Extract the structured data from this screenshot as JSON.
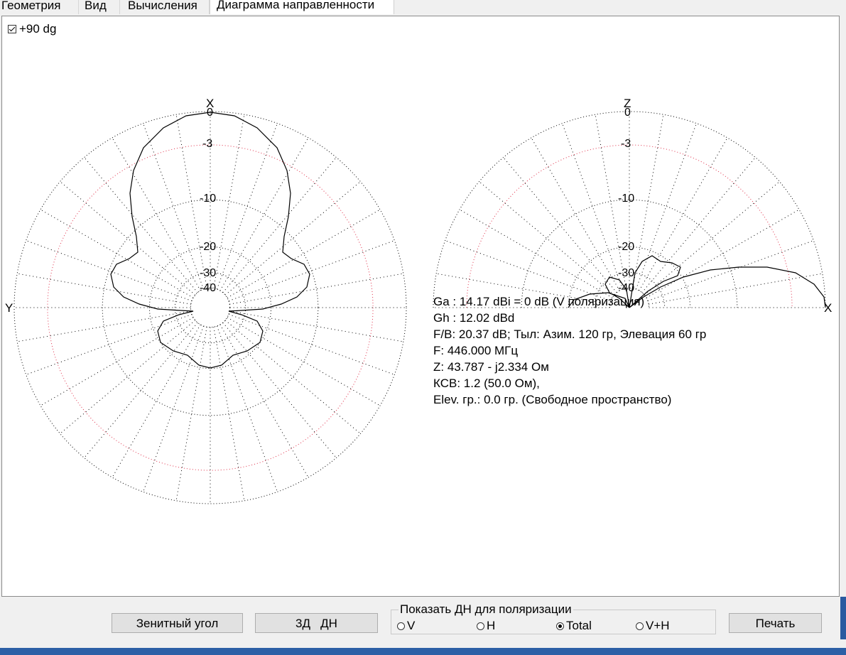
{
  "tabs": [
    "Геометрия",
    "Вид",
    "Вычисления",
    "Диаграмма направленности"
  ],
  "active_tab": "Диаграмма направленности",
  "top_checkbox": {
    "label": "+90 dg",
    "checked": true
  },
  "left_plot": {
    "axis_top": "X",
    "axis_left": "Y",
    "ring_labels": [
      "0",
      "-3",
      "-10",
      "-20",
      "-30",
      "-40"
    ]
  },
  "right_plot": {
    "axis_top": "Z",
    "axis_right": "X",
    "ring_labels": [
      "0",
      "-3",
      "-10",
      "-20",
      "-30",
      "-40"
    ]
  },
  "info": {
    "ga": "Ga : 14.17 dBi = 0 dB  (V поляризация)",
    "gh": "Gh : 12.02 dBd",
    "fb": "F/B: 20.37 dB; Тыл: Азим. 120 гр, Элевация 60 гр",
    "f": "F: 446.000 МГц",
    "z": "Z: 43.787 - j2.334 Ом",
    "ksv": "КСВ: 1.2 (50.0 Ом),",
    "elev": "Elev. гр.: 0.0 гр. (Свободное пространство)"
  },
  "buttons": {
    "zenith": "Зенитный угол",
    "three_d": "3Д   ДН",
    "print": "Печать"
  },
  "polarization": {
    "title": "Показать ДН для поляризации",
    "options": [
      "V",
      "H",
      "Total",
      "V+H"
    ],
    "selected": "Total"
  },
  "colors": {
    "grid": "#000000",
    "ref_ring": "#e0304a",
    "pattern": "#000000"
  }
}
